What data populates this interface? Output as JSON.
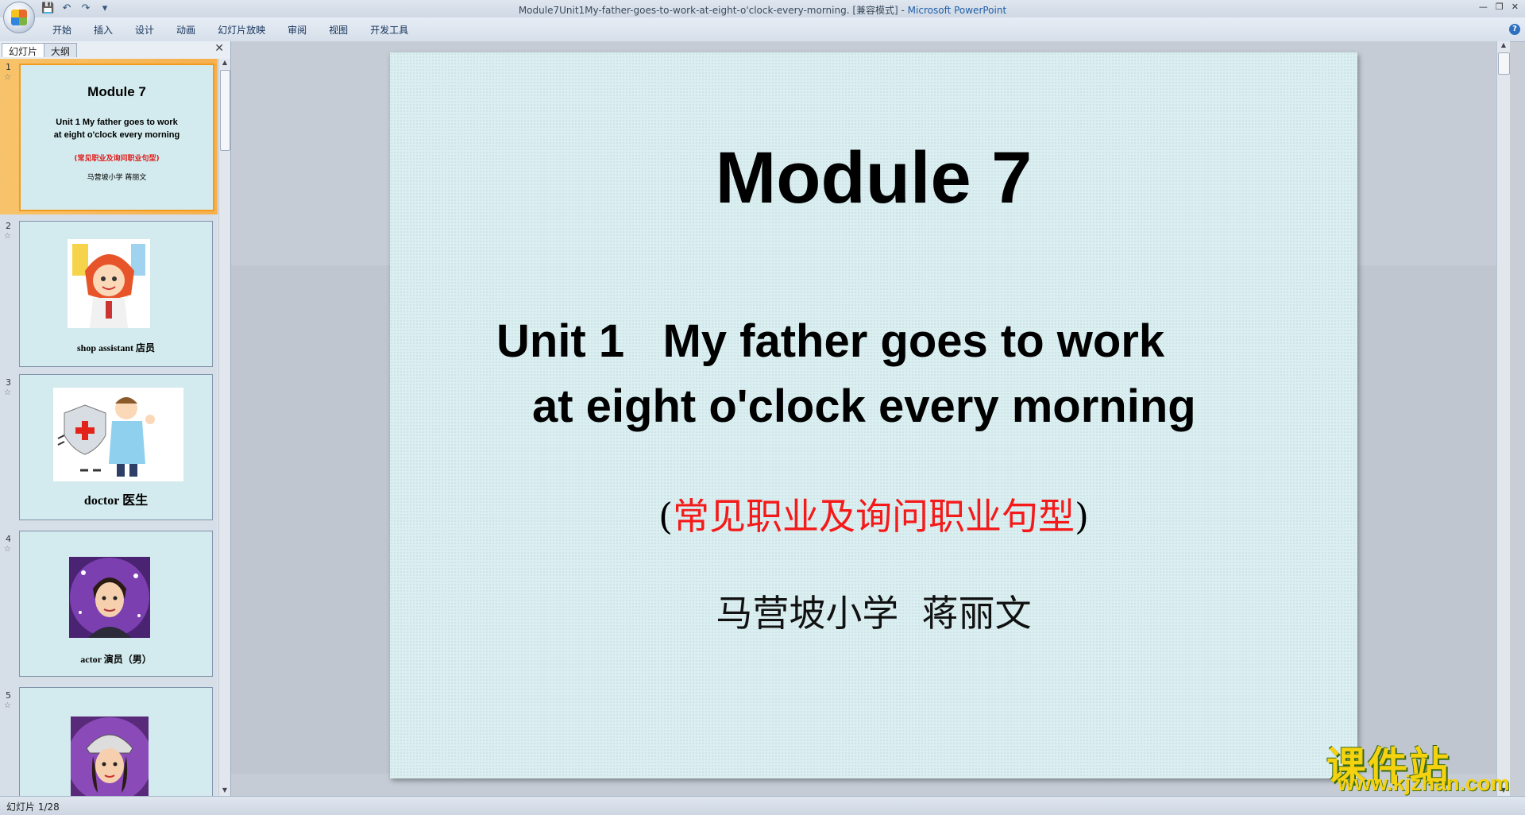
{
  "window": {
    "title_file": "Module7Unit1My-father-goes-to-work-at-eight-o'clock-every-morning. [兼容模式]",
    "title_sep": " - ",
    "title_app": "Microsoft PowerPoint"
  },
  "ribbon": {
    "tabs": [
      "开始",
      "插入",
      "设计",
      "动画",
      "幻灯片放映",
      "审阅",
      "视图",
      "开发工具"
    ]
  },
  "panel": {
    "tabs": [
      "幻灯片",
      "大纲"
    ],
    "thumbnails": [
      {
        "num": "1",
        "title": "Module 7",
        "line1": "Unit 1   My father goes to work",
        "line2": "at eight o'clock every morning",
        "red": "(常见职业及询问职业句型)",
        "small": "马营坡小学   蒋丽文"
      },
      {
        "num": "2",
        "caption": "shop  assistant      店员"
      },
      {
        "num": "3",
        "caption": "doctor      医生"
      },
      {
        "num": "4",
        "caption": "actor      演员（男）"
      },
      {
        "num": "5",
        "caption": ""
      }
    ]
  },
  "slide": {
    "title": "Module 7",
    "unit_line1": "Unit 1   My father goes to work",
    "unit_line2": "at eight o'clock every morning",
    "sub_open": "(",
    "sub_red": "常见职业及询问职业句型",
    "sub_close": ")",
    "author": "马营坡小学  蒋丽文"
  },
  "watermark": {
    "text": "课件站",
    "url": "www.kjzhan.com"
  },
  "status": {
    "slide_indicator": "幻灯片 1/28"
  },
  "colors": {
    "slide_bg": "#dbeff1",
    "accent_red": "#f41a1a",
    "selection": "#f6b04d"
  }
}
